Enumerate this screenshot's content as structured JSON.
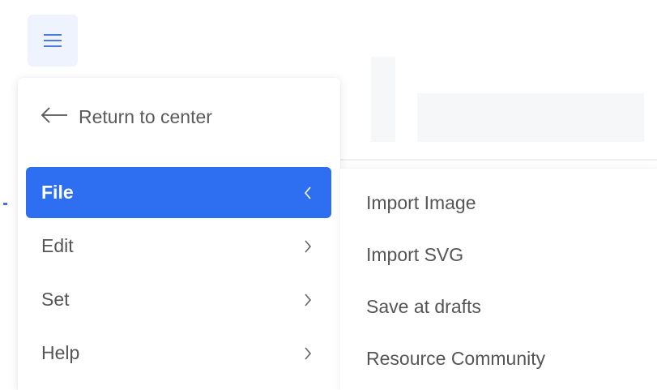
{
  "toolbar": {
    "menu_icon": "hamburger-icon",
    "accent_color": "#2d6ff0"
  },
  "main_menu": {
    "return": {
      "icon": "arrow-left-icon",
      "label": "Return to center"
    },
    "items": [
      {
        "label": "File",
        "icon": "chevron-left-icon",
        "active": true
      },
      {
        "label": "Edit",
        "icon": "chevron-right-icon",
        "active": false
      },
      {
        "label": "Set",
        "icon": "chevron-right-icon",
        "active": false
      },
      {
        "label": "Help",
        "icon": "chevron-right-icon",
        "active": false
      }
    ]
  },
  "file_submenu": {
    "items": [
      {
        "label": "Import Image"
      },
      {
        "label": "Import SVG"
      },
      {
        "label": "Save at drafts"
      },
      {
        "label": "Resource Community"
      }
    ]
  }
}
